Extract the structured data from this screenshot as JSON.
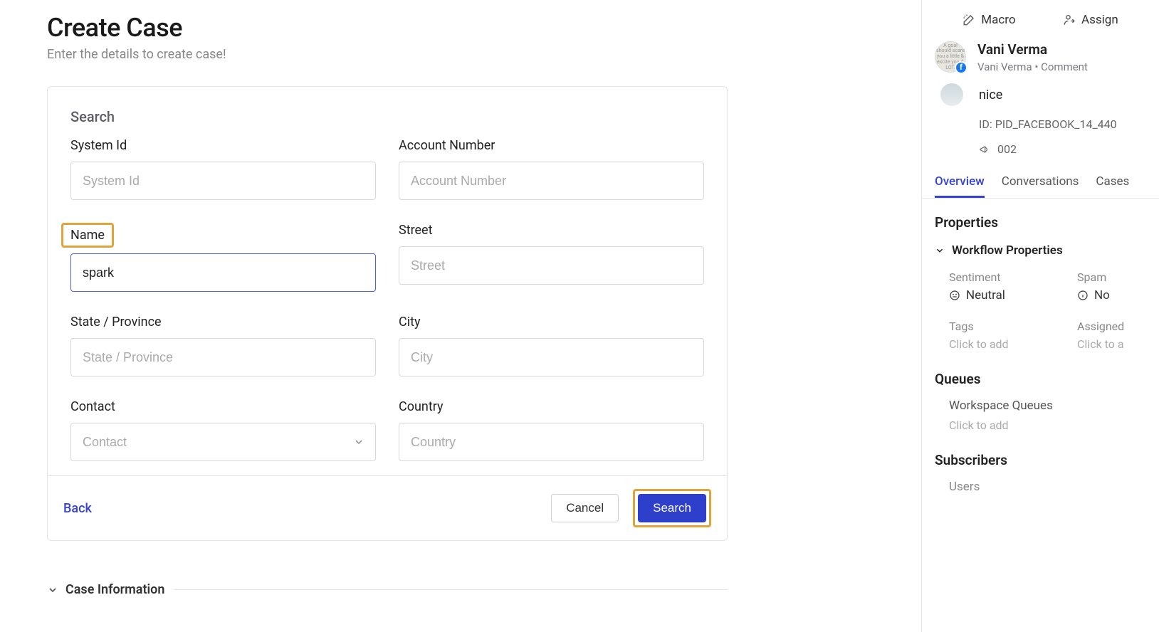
{
  "header": {
    "title": "Create Case",
    "subtitle": "Enter the details to create case!"
  },
  "search_panel": {
    "heading": "Search",
    "fields": {
      "system_id": {
        "label": "System Id",
        "placeholder": "System Id",
        "value": ""
      },
      "account_number": {
        "label": "Account Number",
        "placeholder": "Account Number",
        "value": ""
      },
      "name": {
        "label": "Name",
        "placeholder": "Name",
        "value": "spark"
      },
      "street": {
        "label": "Street",
        "placeholder": "Street",
        "value": ""
      },
      "state": {
        "label": "State / Province",
        "placeholder": "State / Province",
        "value": ""
      },
      "city": {
        "label": "City",
        "placeholder": "City",
        "value": ""
      },
      "contact": {
        "label": "Contact",
        "placeholder": "Contact",
        "value": ""
      },
      "country": {
        "label": "Country",
        "placeholder": "Country",
        "value": ""
      }
    },
    "footer": {
      "back": "Back",
      "cancel": "Cancel",
      "search": "Search"
    }
  },
  "case_info": {
    "title": "Case Information"
  },
  "sidebar": {
    "actions": {
      "macro": "Macro",
      "assign": "Assign"
    },
    "profile": {
      "name": "Vani Verma",
      "meta": "Vani Verma • Comment",
      "nice": "nice",
      "id": "ID: PID_FACEBOOK_14_440",
      "campaign": "002"
    },
    "tabs": {
      "overview": "Overview",
      "conversations": "Conversations",
      "cases": "Cases"
    },
    "properties": {
      "title": "Properties",
      "workflow_title": "Workflow Properties",
      "sentiment": {
        "label": "Sentiment",
        "value": "Neutral"
      },
      "spam": {
        "label": "Spam",
        "value": "No"
      },
      "tags": {
        "label": "Tags",
        "placeholder": "Click to add"
      },
      "assigned": {
        "label": "Assigned",
        "placeholder": "Click to a"
      }
    },
    "queues": {
      "title": "Queues",
      "sub": "Workspace Queues",
      "placeholder": "Click to add"
    },
    "subscribers": {
      "title": "Subscribers",
      "sub": "Users"
    }
  }
}
